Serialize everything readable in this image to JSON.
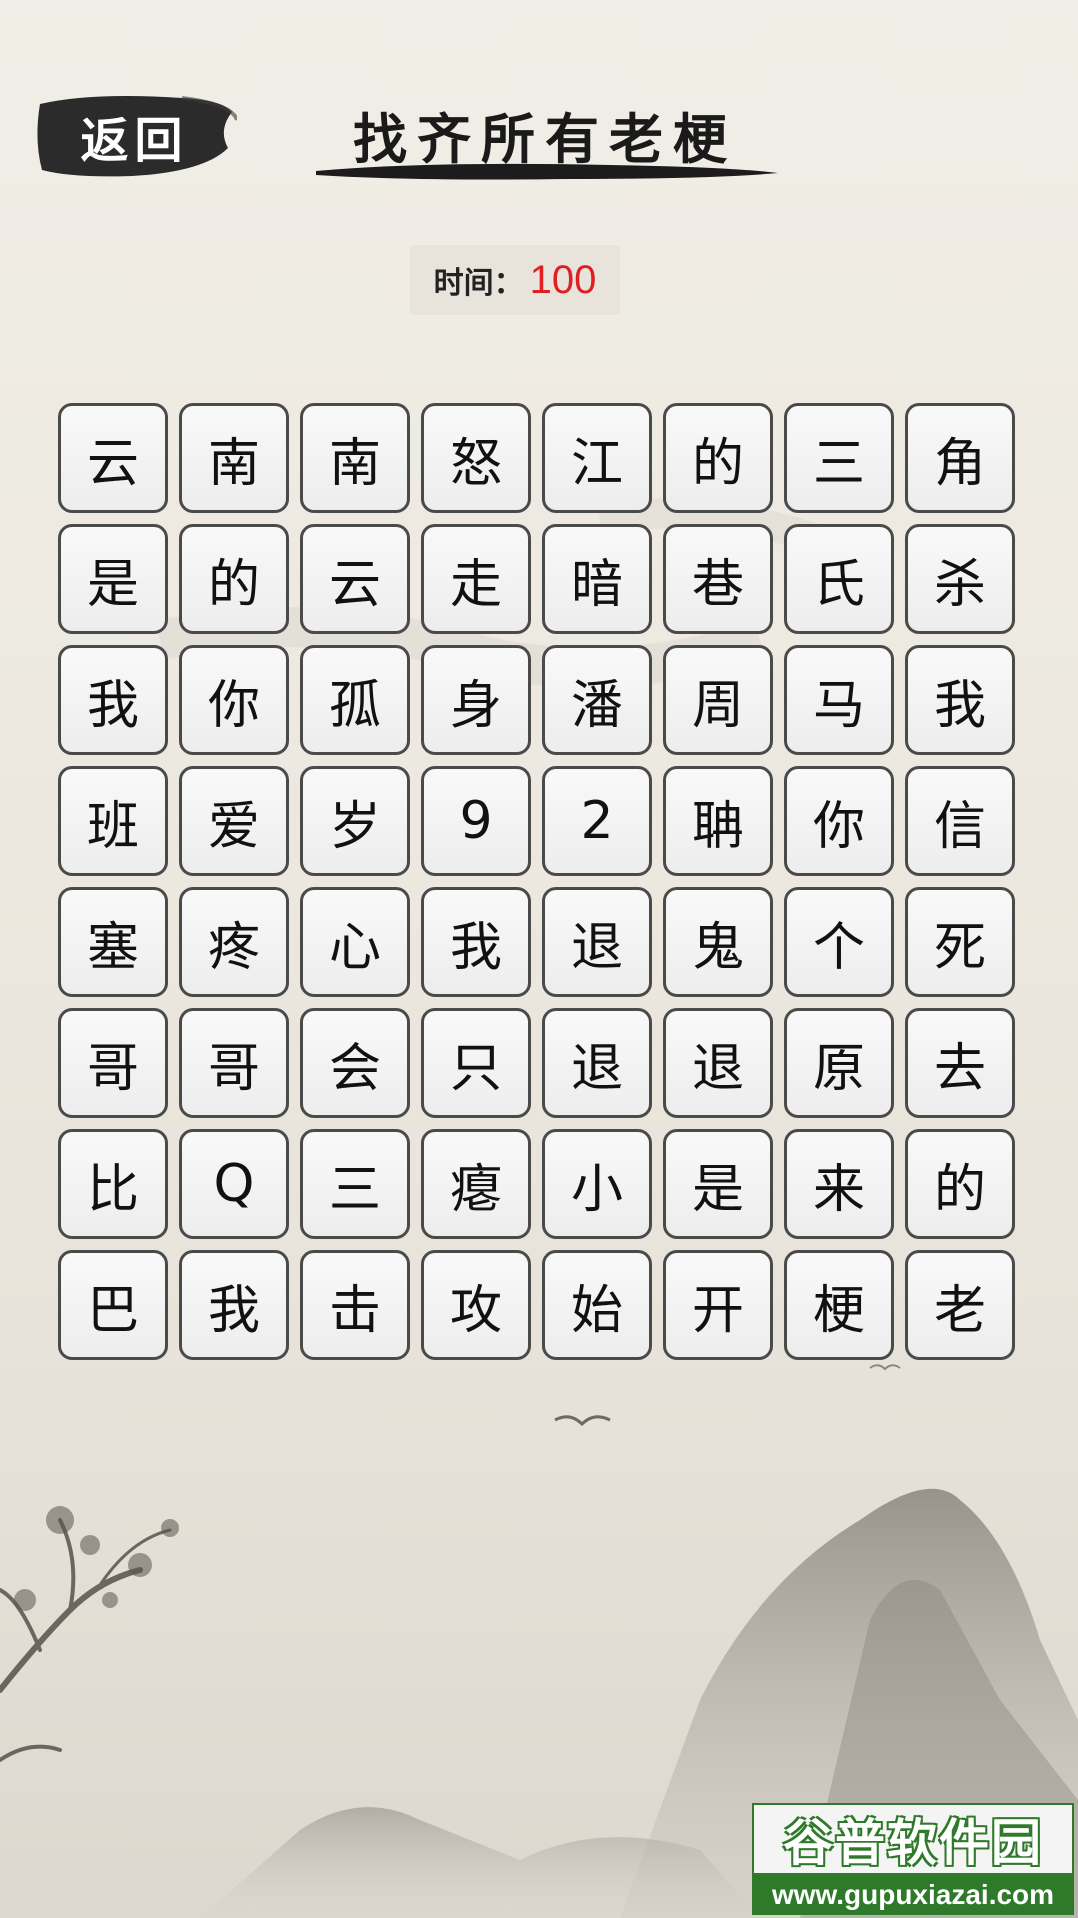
{
  "header": {
    "back_label": "返回",
    "title": "找齐所有老梗"
  },
  "timer": {
    "label": "时间：",
    "value": "100"
  },
  "grid": {
    "rows": [
      [
        "云",
        "南",
        "南",
        "怒",
        "江",
        "的",
        "三",
        "角"
      ],
      [
        "是",
        "的",
        "云",
        "走",
        "暗",
        "巷",
        "氏",
        "杀"
      ],
      [
        "我",
        "你",
        "孤",
        "身",
        "潘",
        "周",
        "马",
        "我"
      ],
      [
        "班",
        "爱",
        "岁",
        "9",
        "2",
        "聃",
        "你",
        "信"
      ],
      [
        "塞",
        "疼",
        "心",
        "我",
        "退",
        "鬼",
        "个",
        "死"
      ],
      [
        "哥",
        "哥",
        "会",
        "只",
        "退",
        "退",
        "原",
        "去"
      ],
      [
        "比",
        "Q",
        "三",
        "瘪",
        "小",
        "是",
        "来",
        "的"
      ],
      [
        "巴",
        "我",
        "击",
        "攻",
        "始",
        "开",
        "梗",
        "老"
      ]
    ]
  },
  "watermark": {
    "name": "谷普软件园",
    "url": "www.gupuxiazai.com"
  },
  "colors": {
    "timer_value": "#e02020",
    "tile_border": "#4a4a4a",
    "tile_background": "#f2f2f2",
    "watermark_green": "#2f7a2a"
  }
}
